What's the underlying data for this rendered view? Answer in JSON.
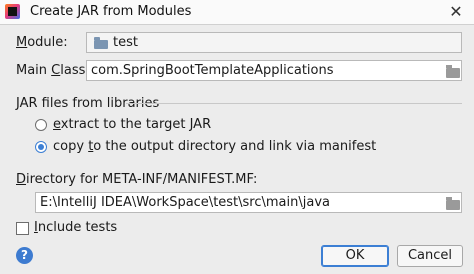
{
  "window": {
    "title": "Create JAR from Modules",
    "close_glyph": "✕"
  },
  "module": {
    "label_mnemonic": "M",
    "label_rest": "odule:",
    "value": "test"
  },
  "main_class": {
    "label_pre": "Main ",
    "label_mnemonic": "C",
    "label_post": "lass:",
    "value": "com.SpringBootTemplateApplications"
  },
  "jar_files": {
    "group_label": "JAR files from libraries",
    "option_extract": {
      "mnemonic": "e",
      "rest": "xtract to the target JAR",
      "selected": false
    },
    "option_copy": {
      "pre": "copy ",
      "mnemonic": "t",
      "rest": "o the output directory and link via manifest",
      "selected": true
    }
  },
  "manifest_dir": {
    "label_mnemonic": "D",
    "label_rest": "irectory for META-INF/MANIFEST.MF:",
    "value": "E:\\IntelliJ IDEA\\WorkSpace\\test\\src\\main\\java"
  },
  "include_tests": {
    "label_mnemonic": "I",
    "label_rest": "nclude tests",
    "checked": false
  },
  "buttons": {
    "help": "?",
    "ok": "OK",
    "cancel": "Cancel"
  },
  "icons": {
    "app": "intellij-app-icon",
    "module": "module-folder-icon",
    "browse": "browse-folder-icon",
    "help": "help-icon"
  },
  "colors": {
    "accent": "#3c7fd4",
    "dialog_bg": "#ececec"
  }
}
